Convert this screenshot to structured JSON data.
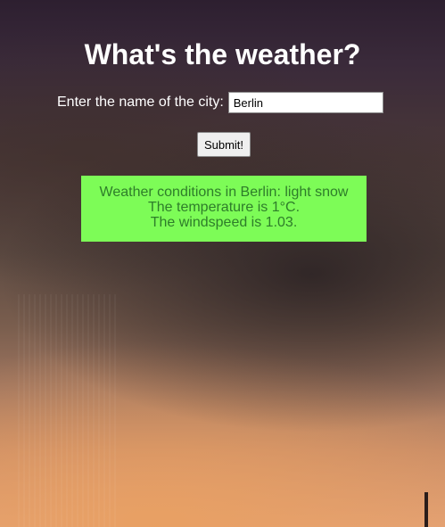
{
  "page": {
    "heading": "What's the weather?"
  },
  "form": {
    "city_label": "Enter the name of the city:",
    "city_value": "Berlin",
    "submit_label": "Submit!"
  },
  "result": {
    "line1": "Weather conditions in Berlin: light snow",
    "line2": "The temperature is 1°C.",
    "line3": "The windspeed is 1.03."
  },
  "colors": {
    "result_background": "#7dfc57",
    "result_text": "#2e7d2a",
    "heading_text": "#ffffff"
  }
}
